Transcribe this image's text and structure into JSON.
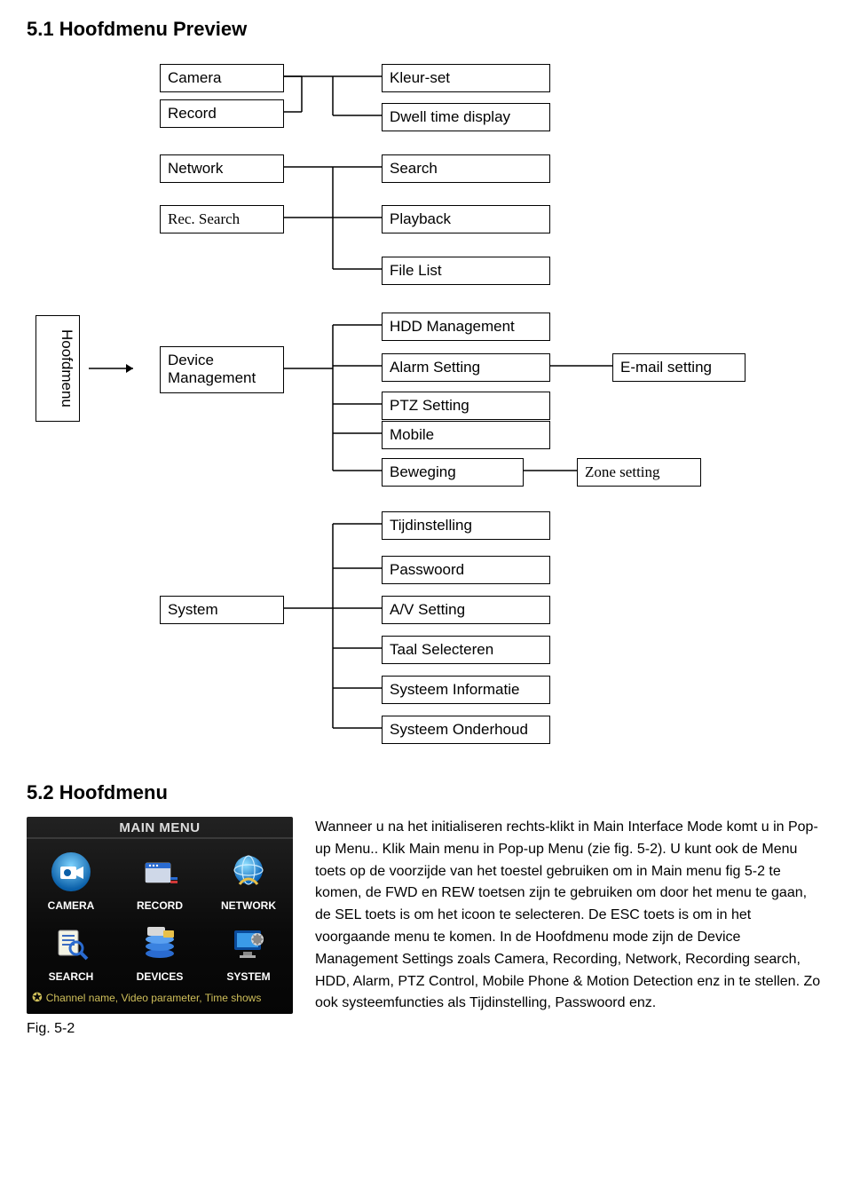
{
  "sec1_title": "5.1 Hoofdmenu Preview",
  "diagram": {
    "hoofdmenu": "Hoofdmenu",
    "camera": "Camera",
    "record": "Record",
    "network": "Network",
    "rec_search": "Rec. Search",
    "device_mgmt": "Device\nManagement",
    "system": "System",
    "kleur_set": "Kleur-set",
    "dwell": "Dwell time display",
    "search": "Search",
    "playback": "Playback",
    "file_list": "File List",
    "hdd_mgmt": "HDD Management",
    "alarm_setting": "Alarm Setting",
    "ptz_setting": "PTZ Setting",
    "mobile": "Mobile",
    "beweging": "Beweging",
    "tijdinstelling": "Tijdinstelling",
    "passwoord": "Passwoord",
    "av_setting": "A/V Setting",
    "taal_sel": "Taal Selecteren",
    "sys_info": "Systeem Informatie",
    "sys_onderh": "Systeem Onderhoud",
    "email_setting": "E-mail setting",
    "zone_setting": "Zone setting"
  },
  "sec2_title": "5.2 Hoofdmenu",
  "fig_caption": "Fig. 5-2",
  "mainmenu": {
    "title": "MAIN MENU",
    "items": [
      "CAMERA",
      "RECORD",
      "NETWORK",
      "SEARCH",
      "DEVICES",
      "SYSTEM"
    ],
    "footer": "Channel name, Video parameter, Time shows"
  },
  "body_text": "Wanneer u na het initialiseren rechts-klikt in Main Interface Mode komt u in Pop-up Menu.. Klik Main menu in Pop-up Menu (zie fig. 5-2). U kunt ook de Menu toets op de voorzijde van het toestel gebruiken om in Main menu fig 5-2 te komen, de FWD en REW toetsen zijn te gebruiken om door het menu te gaan, de SEL toets is om het icoon te selecteren. De ESC toets is om in het voorgaande menu te komen. In de Hoofdmenu mode zijn de Device Management Settings zoals Camera, Recording, Network, Recording search, HDD, Alarm, PTZ Control, Mobile Phone & Motion Detection enz in te stellen. Zo ook systeemfuncties als Tijdinstelling, Passwoord enz."
}
